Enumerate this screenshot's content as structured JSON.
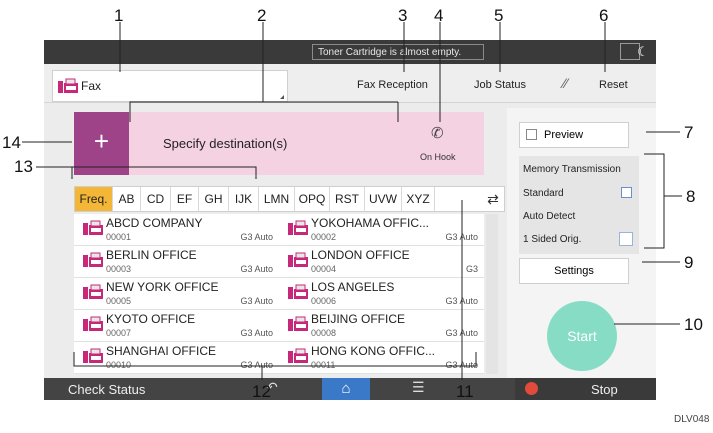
{
  "callouts": [
    "1",
    "2",
    "3",
    "4",
    "5",
    "6",
    "7",
    "8",
    "9",
    "10",
    "11",
    "12",
    "13",
    "14"
  ],
  "figure_id": "DLV048",
  "status_bar": {
    "message": "Toner Cartridge is almost empty."
  },
  "toolbar": {
    "app_name": "Fax",
    "fax_reception": "Fax Reception",
    "job_status": "Job Status",
    "reset": "Reset"
  },
  "destination": {
    "add_symbol": "+",
    "prompt": "Specify destination(s)",
    "on_hook": "On Hook"
  },
  "tabs": [
    "Freq.",
    "AB",
    "CD",
    "EF",
    "GH",
    "IJK",
    "LMN",
    "OPQ",
    "RST",
    "UVW",
    "XYZ"
  ],
  "entries": [
    {
      "name": "ABCD COMPANY",
      "num": "00001",
      "mode": "G3 Auto"
    },
    {
      "name": "YOKOHAMA OFFIC...",
      "num": "00002",
      "mode": "G3 Auto"
    },
    {
      "name": "BERLIN OFFICE",
      "num": "00003",
      "mode": "G3 Auto"
    },
    {
      "name": "LONDON OFFICE",
      "num": "00004",
      "mode": "G3"
    },
    {
      "name": "NEW YORK OFFICE",
      "num": "00005",
      "mode": "G3 Auto"
    },
    {
      "name": "LOS ANGELES",
      "num": "00006",
      "mode": "G3 Auto"
    },
    {
      "name": "KYOTO OFFICE",
      "num": "00007",
      "mode": "G3 Auto"
    },
    {
      "name": "BEIJING OFFICE",
      "num": "00008",
      "mode": "G3 Auto"
    },
    {
      "name": "SHANGHAI  OFFICE",
      "num": "00010",
      "mode": "G3 Auto"
    },
    {
      "name": "HONG KONG OFFIC...",
      "num": "00011",
      "mode": "G3 Auto"
    }
  ],
  "right_panel": {
    "preview": "Preview",
    "memory_transmission": "Memory Transmission",
    "standard": "Standard",
    "auto_detect": "Auto Detect",
    "sided": "1 Sided Orig.",
    "settings": "Settings",
    "start": "Start"
  },
  "bottom_bar": {
    "check_status": "Check Status",
    "stop": "Stop"
  },
  "colors": {
    "destination_bg": "#f5d2e2",
    "add_button": "#9e4388",
    "tab_active": "#f4b636",
    "start_button": "#86dcc4",
    "fax_icon": "#c8287a"
  }
}
